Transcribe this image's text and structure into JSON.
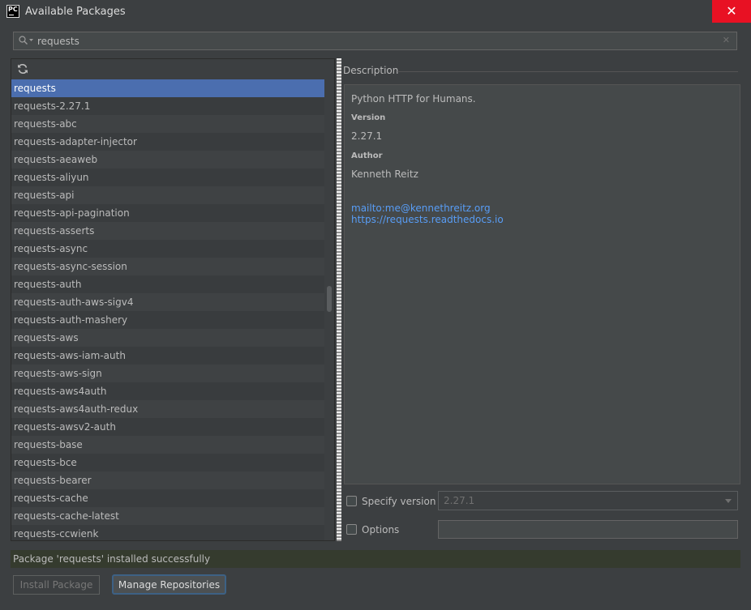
{
  "window": {
    "title": "Available Packages",
    "close_glyph": "✕",
    "app_icon_text": "PC"
  },
  "search": {
    "value": "requests",
    "clear_glyph": "✕"
  },
  "packages": [
    "requests",
    "requests-2.27.1",
    "requests-abc",
    "requests-adapter-injector",
    "requests-aeaweb",
    "requests-aliyun",
    "requests-api",
    "requests-api-pagination",
    "requests-asserts",
    "requests-async",
    "requests-async-session",
    "requests-auth",
    "requests-auth-aws-sigv4",
    "requests-auth-mashery",
    "requests-aws",
    "requests-aws-iam-auth",
    "requests-aws-sign",
    "requests-aws4auth",
    "requests-aws4auth-redux",
    "requests-awsv2-auth",
    "requests-base",
    "requests-bce",
    "requests-bearer",
    "requests-cache",
    "requests-cache-latest",
    "requests-ccwienk"
  ],
  "selected_package": "requests",
  "description": {
    "header": "Description",
    "summary": "Python HTTP for Humans.",
    "version_label": "Version",
    "version": "2.27.1",
    "author_label": "Author",
    "author": "Kenneth Reitz",
    "links": [
      "mailto:me@kennethreitz.org",
      "https://requests.readthedocs.io"
    ]
  },
  "options": {
    "specify_version_label": "Specify version",
    "specify_version_value": "2.27.1",
    "options_label": "Options",
    "options_value": ""
  },
  "status": "Package 'requests' installed successfully",
  "buttons": {
    "install": "Install Package",
    "manage": "Manage Repositories"
  },
  "colors": {
    "selection": "#4b6eaf",
    "link": "#589df6",
    "close": "#e81123",
    "status_bg": "#353b2e"
  },
  "icons": {
    "search": "search-icon",
    "refresh": "refresh-icon",
    "clear": "close-icon",
    "dropdown": "chevron-down-icon"
  }
}
